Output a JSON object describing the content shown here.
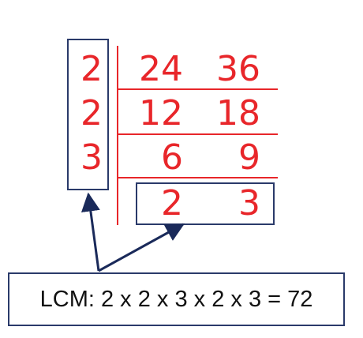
{
  "divisors": [
    "2",
    "2",
    "3"
  ],
  "rows": [
    [
      "24",
      "36"
    ],
    [
      "12",
      "18"
    ],
    [
      "6",
      "9"
    ],
    [
      "2",
      "3"
    ]
  ],
  "result": {
    "text": "LCM: 2 x 2 x 3 x 2 x 3 = 72"
  },
  "colors": {
    "digits": "#e8262a",
    "rules": "#e8262a",
    "boxes": "#2a3a6a",
    "arrows": "#1a2a5a"
  }
}
